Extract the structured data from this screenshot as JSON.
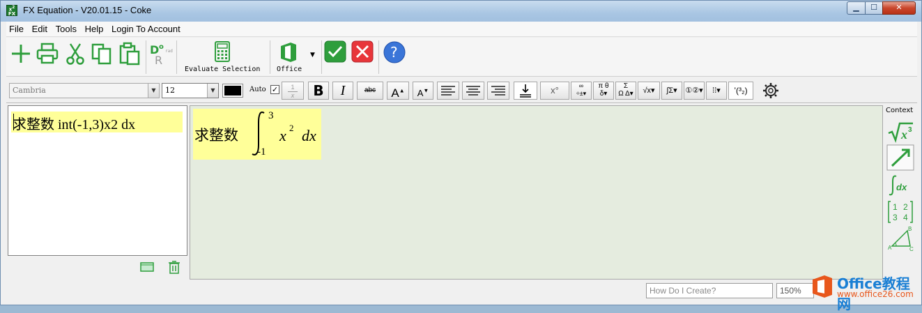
{
  "window": {
    "title": "FX Equation - V20.01.15 - Coke"
  },
  "menu": [
    {
      "label": "File"
    },
    {
      "label": "Edit"
    },
    {
      "label": "Tools"
    },
    {
      "label": "Help"
    },
    {
      "label": "Login To Account"
    }
  ],
  "toolbar": {
    "evaluate_label": "Evaluate Selection",
    "office_label": "Office",
    "degrees_rad_label": "rad"
  },
  "format": {
    "font": "Cambria",
    "size": "12",
    "auto_label": "Auto",
    "auto_checked": "✓",
    "fraction_num": "1",
    "fraction_den": "x",
    "bold": "B",
    "italic": "I",
    "strike": "abc",
    "superscript": "x°"
  },
  "editor": {
    "text": "求整数 int(-1,3)x2 dx"
  },
  "preview": {
    "prefix": "求整数",
    "upper": "3",
    "lower": "-1",
    "var": "x",
    "power": "2",
    "diff": "dx"
  },
  "context": {
    "title": "Context"
  },
  "status": {
    "help_placeholder": "How Do I Create?",
    "zoom": "150%"
  },
  "watermark": {
    "title": "Office教程网",
    "url": "www.office26.com"
  },
  "colors": {
    "accent_green": "#2e9e3c",
    "cancel_red": "#e8353a",
    "help_blue": "#3a75d8",
    "highlight": "#ffff99",
    "preview_bg": "#e5ecdf"
  }
}
